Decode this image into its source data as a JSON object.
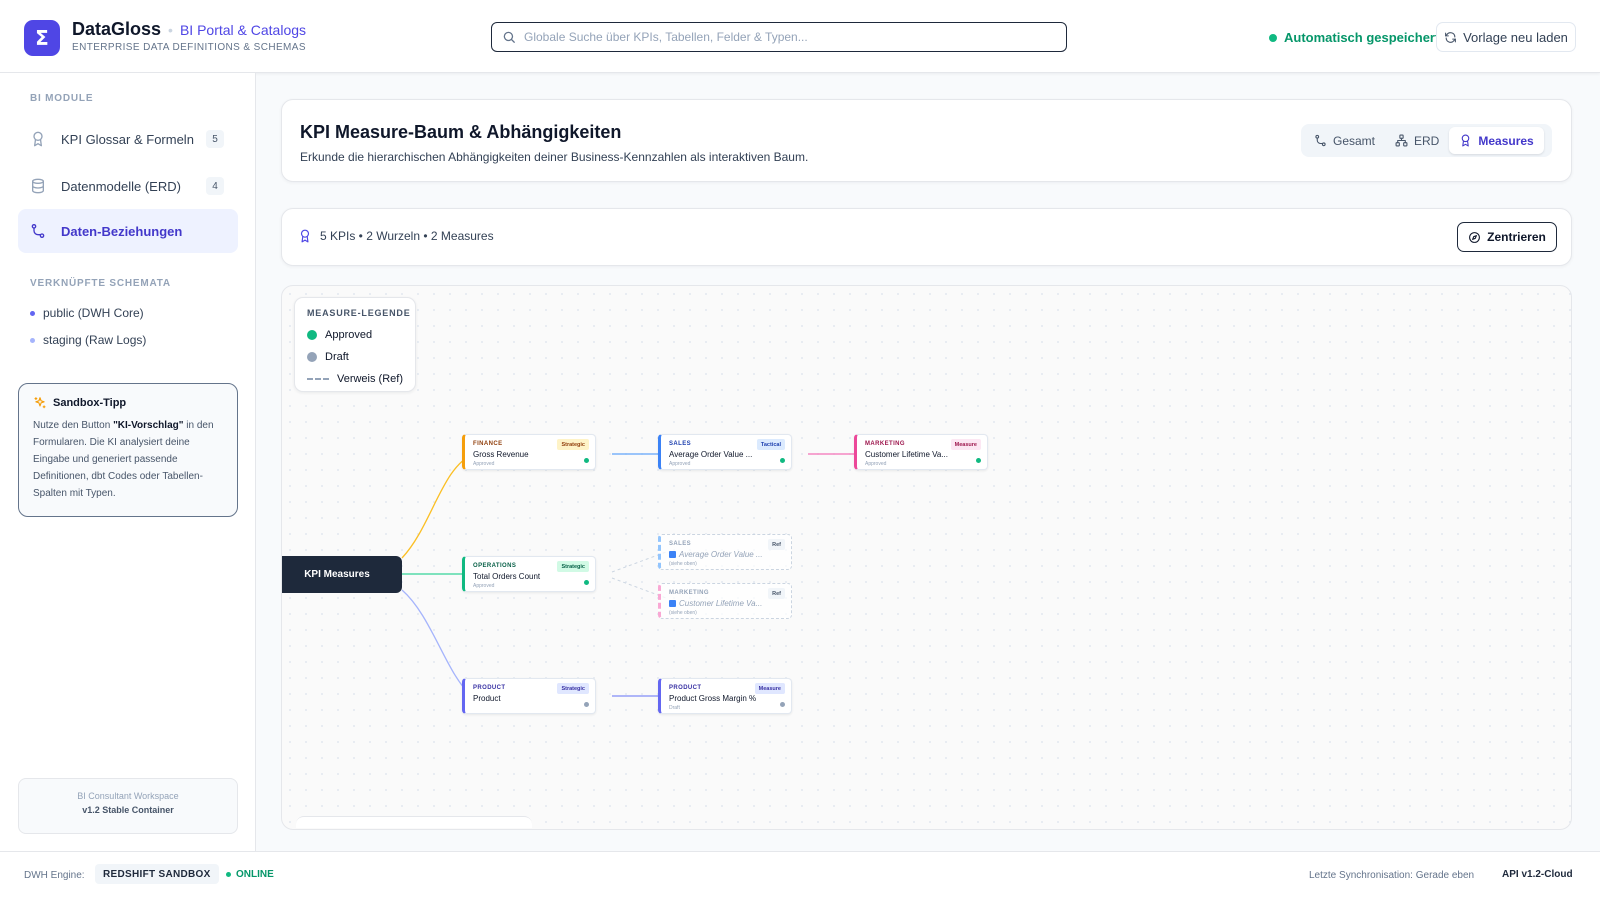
{
  "header": {
    "logo_glyph": "Σ",
    "brand_name": "DataGloss",
    "brand_sub": "BI Portal & Catalogs",
    "brand_tagline": "ENTERPRISE DATA DEFINITIONS & SCHEMAS",
    "search_placeholder": "Globale Suche über KPIs, Tabellen, Felder & Typen...",
    "search_value": "",
    "autosave_label": "Automatisch gespeichert",
    "reload_label": "Vorlage neu laden",
    "accent_color": "#4f46e5"
  },
  "sidebar": {
    "section_modules": "BI MODULE",
    "items": [
      {
        "label": "KPI Glossar & Formeln",
        "count": "5",
        "icon": "award-icon"
      },
      {
        "label": "Datenmodelle (ERD)",
        "count": "4",
        "icon": "database-icon"
      },
      {
        "label": "Daten-Beziehungen",
        "icon": "relation-icon",
        "active": true
      }
    ],
    "section_schemas": "VERKNÜPFTE SCHEMATA",
    "schemas": [
      {
        "label": "public (DWH Core)",
        "color": "#6366f1"
      },
      {
        "label": "staging (Raw Logs)",
        "color": "#a5b4fc"
      }
    ],
    "tip": {
      "title": "Sandbox-Tipp",
      "text_1": "Nutze den Button ",
      "highlight": "\"KI-Vorschlag\"",
      "text_2": " in den Formularen. Die KI analysiert deine Eingabe und generiert passende Definitionen, dbt Codes oder Tabellen-Spalten mit Typen."
    },
    "workspace": {
      "line1": "BI Consultant Workspace",
      "line2": "v1.2 Stable Container"
    }
  },
  "main": {
    "title": "KPI Measure-Baum & Abhängigkeiten",
    "subtitle": "Erkunde die hierarchischen Abhängigkeiten deiner Business-Kennzahlen als interaktiven Baum.",
    "view_tabs": [
      {
        "label": "Gesamt",
        "icon": "relation-icon"
      },
      {
        "label": "ERD",
        "icon": "sitemap-icon"
      },
      {
        "label": "Measures",
        "icon": "award-icon",
        "active": true
      }
    ],
    "stats": "5 KPIs • 2 Wurzeln • 2 Measures",
    "center_label": "Zentrieren"
  },
  "tree": {
    "legend": {
      "title": "MEASURE-LEGENDE",
      "approved": "Approved",
      "draft": "Draft",
      "ref": "Verweis (Ref)"
    },
    "root_label": "KPI Measures",
    "nodes": [
      {
        "id": "gross-revenue",
        "category": "FINANCE",
        "name": "Gross Revenue",
        "status": "Approved",
        "badge": "Strategic",
        "color": "#f59e0b",
        "badge_bg": "#fef3c7",
        "badge_fg": "#92400e"
      },
      {
        "id": "aov",
        "category": "SALES",
        "name": "Average Order Value ...",
        "status": "Approved",
        "badge": "Tactical",
        "color": "#3b82f6",
        "badge_bg": "#dbeafe",
        "badge_fg": "#1e40af"
      },
      {
        "id": "clv",
        "category": "MARKETING",
        "name": "Customer Lifetime Va...",
        "status": "Approved",
        "badge": "Measure",
        "color": "#ec4899",
        "badge_bg": "#fce7f3",
        "badge_fg": "#9d174d"
      },
      {
        "id": "orders",
        "category": "OPERATIONS",
        "name": "Total Orders Count",
        "status": "Approved",
        "badge": "Strategic",
        "color": "#10b981",
        "badge_bg": "#d1fae5",
        "badge_fg": "#065f46"
      },
      {
        "id": "ref-aov",
        "category": "SALES",
        "name": "Average Order Value ...",
        "status": "(siehe oben)",
        "badge": "Ref",
        "color": "#93c5fd",
        "badge_bg": "#f1f5f9",
        "badge_fg": "#475569",
        "ref": true
      },
      {
        "id": "ref-clv",
        "category": "MARKETING",
        "name": "Customer Lifetime Va...",
        "status": "(siehe oben)",
        "badge": "Ref",
        "color": "#f9a8d4",
        "badge_bg": "#f1f5f9",
        "badge_fg": "#475569",
        "ref": true
      },
      {
        "id": "product",
        "category": "PRODUCT",
        "name": "Product",
        "status": "",
        "badge": "Strategic",
        "color": "#6366f1",
        "badge_bg": "#e0e7ff",
        "badge_fg": "#3730a3"
      },
      {
        "id": "pgm",
        "category": "PRODUCT",
        "name": "Product Gross Margin %",
        "status": "Draft",
        "badge": "Measure",
        "color": "#6366f1",
        "badge_bg": "#e0e7ff",
        "badge_fg": "#3730a3"
      }
    ],
    "status_colors": {
      "approved": "#10b981",
      "draft": "#94a3b8"
    }
  },
  "footer": {
    "engine_label": "DWH Engine:",
    "engine_name": "REDSHIFT SANDBOX",
    "online": "ONLINE",
    "sync": "Letzte Synchronisation: Gerade eben",
    "api": "API v1.2-Cloud"
  }
}
